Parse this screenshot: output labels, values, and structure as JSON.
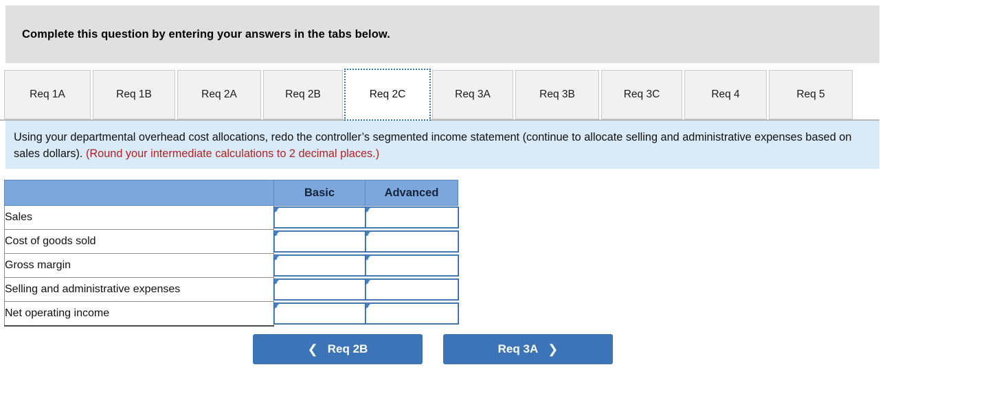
{
  "banner": {
    "text": "Complete this question by entering your answers in the tabs below."
  },
  "tabs": [
    {
      "label": "Req 1A",
      "active": false
    },
    {
      "label": "Req 1B",
      "active": false
    },
    {
      "label": "Req 2A",
      "active": false
    },
    {
      "label": "Req 2B",
      "active": false
    },
    {
      "label": "Req 2C",
      "active": true
    },
    {
      "label": "Req 3A",
      "active": false
    },
    {
      "label": "Req 3B",
      "active": false
    },
    {
      "label": "Req 3C",
      "active": false
    },
    {
      "label": "Req 4",
      "active": false
    },
    {
      "label": "Req 5",
      "active": false
    }
  ],
  "instruction": {
    "main": "Using your departmental overhead cost allocations, redo the controller’s segmented income statement (continue to allocate selling and administrative expenses based on sales dollars).",
    "note": "(Round your intermediate calculations to 2 decimal places.)"
  },
  "table": {
    "headers": [
      "",
      "Basic",
      "Advanced"
    ],
    "rows": [
      {
        "label": "Sales",
        "basic": "",
        "advanced": ""
      },
      {
        "label": "Cost of goods sold",
        "basic": "",
        "advanced": ""
      },
      {
        "label": "Gross margin",
        "basic": "",
        "advanced": ""
      },
      {
        "label": "Selling and administrative expenses",
        "basic": "",
        "advanced": ""
      },
      {
        "label": "Net operating income",
        "basic": "",
        "advanced": ""
      }
    ]
  },
  "nav": {
    "prev_label": "Req 2B",
    "prev_icon": "chevron-left-icon",
    "next_label": "Req 3A",
    "next_icon": "chevron-right-icon"
  },
  "colors": {
    "banner_bg": "#e0e0e0",
    "instruction_bg": "#d9ebf9",
    "note_red": "#b22222",
    "table_header_blue": "#7ba7dc",
    "button_blue": "#3d74b8",
    "tab_inactive_bg": "#f1f1f1",
    "tab_active_border": "#2f72bd"
  }
}
